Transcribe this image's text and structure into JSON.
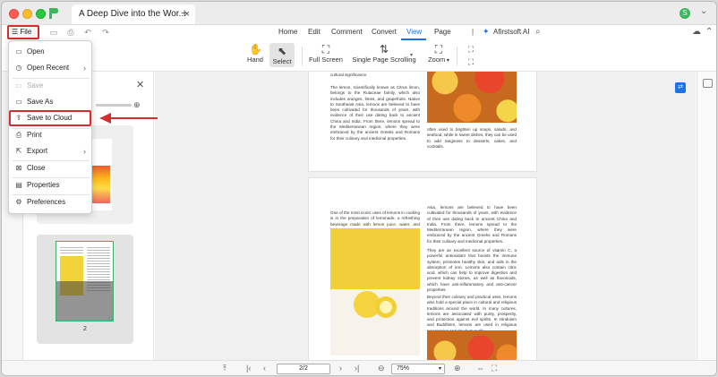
{
  "titlebar": {
    "tab_title": "A Deep Dive into the Wor...",
    "tab_close": "×",
    "new_tab": "+",
    "avatar_letter": "S",
    "chevron": "⌄"
  },
  "menubar": {
    "file_label": "☰ File",
    "tabs": [
      {
        "label": "Home"
      },
      {
        "label": "Edit"
      },
      {
        "label": "Comment"
      },
      {
        "label": "Convert"
      },
      {
        "label": "View"
      },
      {
        "label": "Page"
      }
    ],
    "ai_label": "Afirstsoft AI"
  },
  "toolbar": {
    "hand": "Hand",
    "select": "Select",
    "full_screen": "Full Screen",
    "single_page_scrolling": "Single Page Scrolling",
    "zoom": "Zoom"
  },
  "file_menu": {
    "items": [
      {
        "label": "Open",
        "icon": "folder-icon",
        "enabled": true
      },
      {
        "label": "Open Recent",
        "icon": "clock-icon",
        "enabled": true,
        "submenu": true
      },
      {
        "label": "Save",
        "icon": "save-icon",
        "enabled": false
      },
      {
        "label": "Save As",
        "icon": "save-as-icon",
        "enabled": true
      },
      {
        "label": "Save to Cloud",
        "icon": "cloud-upload-icon",
        "enabled": true,
        "highlighted": true
      },
      {
        "label": "Print",
        "icon": "print-icon",
        "enabled": true
      },
      {
        "label": "Export",
        "icon": "export-icon",
        "enabled": true,
        "submenu": true
      },
      {
        "label": "Close",
        "icon": "close-doc-icon",
        "enabled": true
      },
      {
        "label": "Properties",
        "icon": "properties-icon",
        "enabled": true
      },
      {
        "label": "Preferences",
        "icon": "preferences-icon",
        "enabled": true
      }
    ]
  },
  "thumbnails": {
    "page2_number": "2"
  },
  "document": {
    "p1_left_top": "cultural significance.",
    "p1_left_body": "The lemon, scientifically known as Citrus limon, belongs to the Rutaceae family, which also includes oranges, limes, and grapefruits. Native to Southeast Asia, lemons are believed to have been cultivated for thousands of years, with evidence of their use dating back to ancient China and India. From there, lemons spread to the Mediterranean region, where they were embraced by the ancient Greeks and Romans for their culinary and medicinal properties.",
    "p1_right_body": "often used to brighten up soups, salads, and seafood, while in sweet dishes, they can be used to add tanginess to desserts, cakes, and cocktails.",
    "p2_left_top": "One of the most iconic uses of lemons in cooking is in the preparation of lemonade, a refreshing beverage made with lemon juice, water, and sweetener.",
    "p2_right_1": "Asia, lemons are believed to have been cultivated for thousands of years, with evidence of their use dating back to ancient China and India. From there, lemons spread to the Mediterranean region, where they were embraced by the ancient Greeks and Romans for their culinary and medicinal properties.",
    "p2_right_2": "They are an excellent source of vitamin C, a powerful antioxidant that boosts the immune system, promotes healthy skin, and aids in the absorption of iron. Lemons also contain citric acid, which can help to improve digestion and prevent kidney stones, as well as flavonoids, which have anti-inflammatory and anti-cancer properties.",
    "p2_right_3": "Beyond their culinary and practical uses, lemons also hold a special place in cultural and religious traditions around the world. In many cultures, lemons are associated with purity, prosperity, and protection against evil spirits. In Hinduism and Buddhism, lemons are used in religious ceremonies and rituals to purify"
  },
  "bottombar": {
    "page_value": "2/2",
    "zoom_value": "75%"
  },
  "colors": {
    "accent": "#1a73e8",
    "highlight_red": "#d32f2f",
    "brand_green": "#3bb75e"
  }
}
